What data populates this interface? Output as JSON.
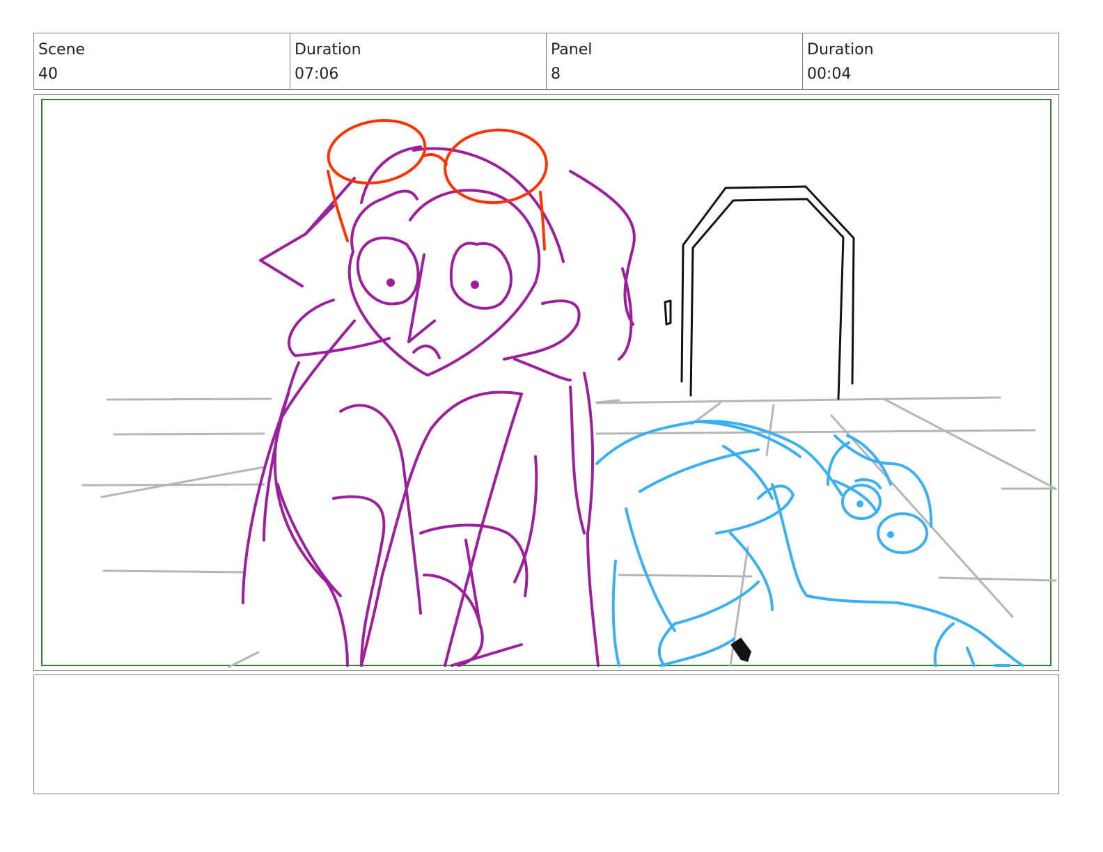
{
  "header": {
    "scene_label": "Scene",
    "scene_value": "40",
    "scene_duration_label": "Duration",
    "scene_duration_value": "07:06",
    "panel_label": "Panel",
    "panel_value": "8",
    "panel_duration_label": "Duration",
    "panel_duration_value": "00:04"
  },
  "colors": {
    "safe_frame": "#2e7d32",
    "character_purple": "#9c1f9c",
    "glasses_red": "#ff3300",
    "character_blue": "#3ab0f2",
    "background_gray": "#b5b5b5",
    "door_black": "#111111"
  },
  "notes": {
    "text": ""
  }
}
